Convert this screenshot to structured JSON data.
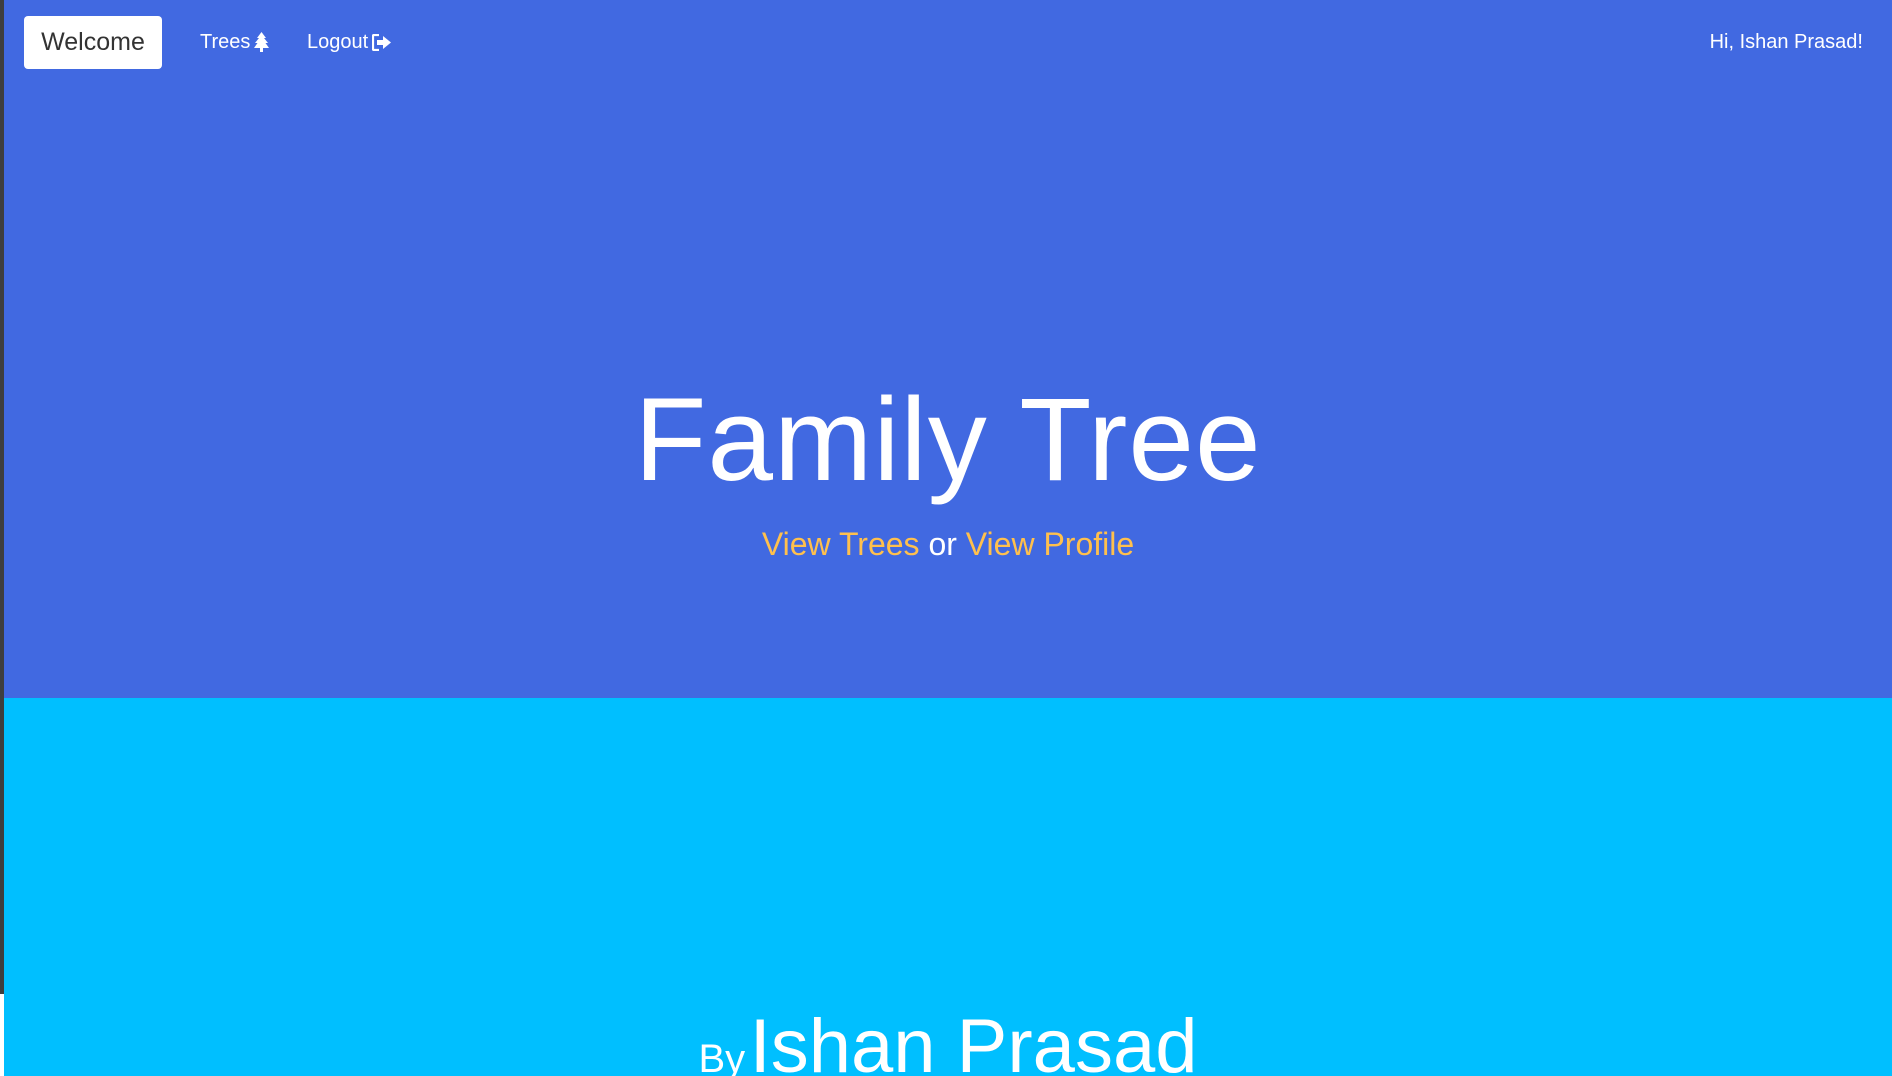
{
  "nav": {
    "welcome_label": "Welcome",
    "trees_label": "Trees",
    "trees_icon": "tree-icon",
    "logout_label": "Logout",
    "logout_icon": "sign-out-icon",
    "greeting": "Hi, Ishan Prasad!"
  },
  "hero": {
    "title": "Family Tree",
    "link_trees": "View Trees",
    "separator": "or",
    "link_profile": "View Profile"
  },
  "footer": {
    "by_label": "By",
    "author": "Ishan Prasad"
  },
  "colors": {
    "hero_bg": "#4169e1",
    "lower_bg": "#00bfff",
    "link_accent": "#ffc04d",
    "text": "#ffffff"
  }
}
